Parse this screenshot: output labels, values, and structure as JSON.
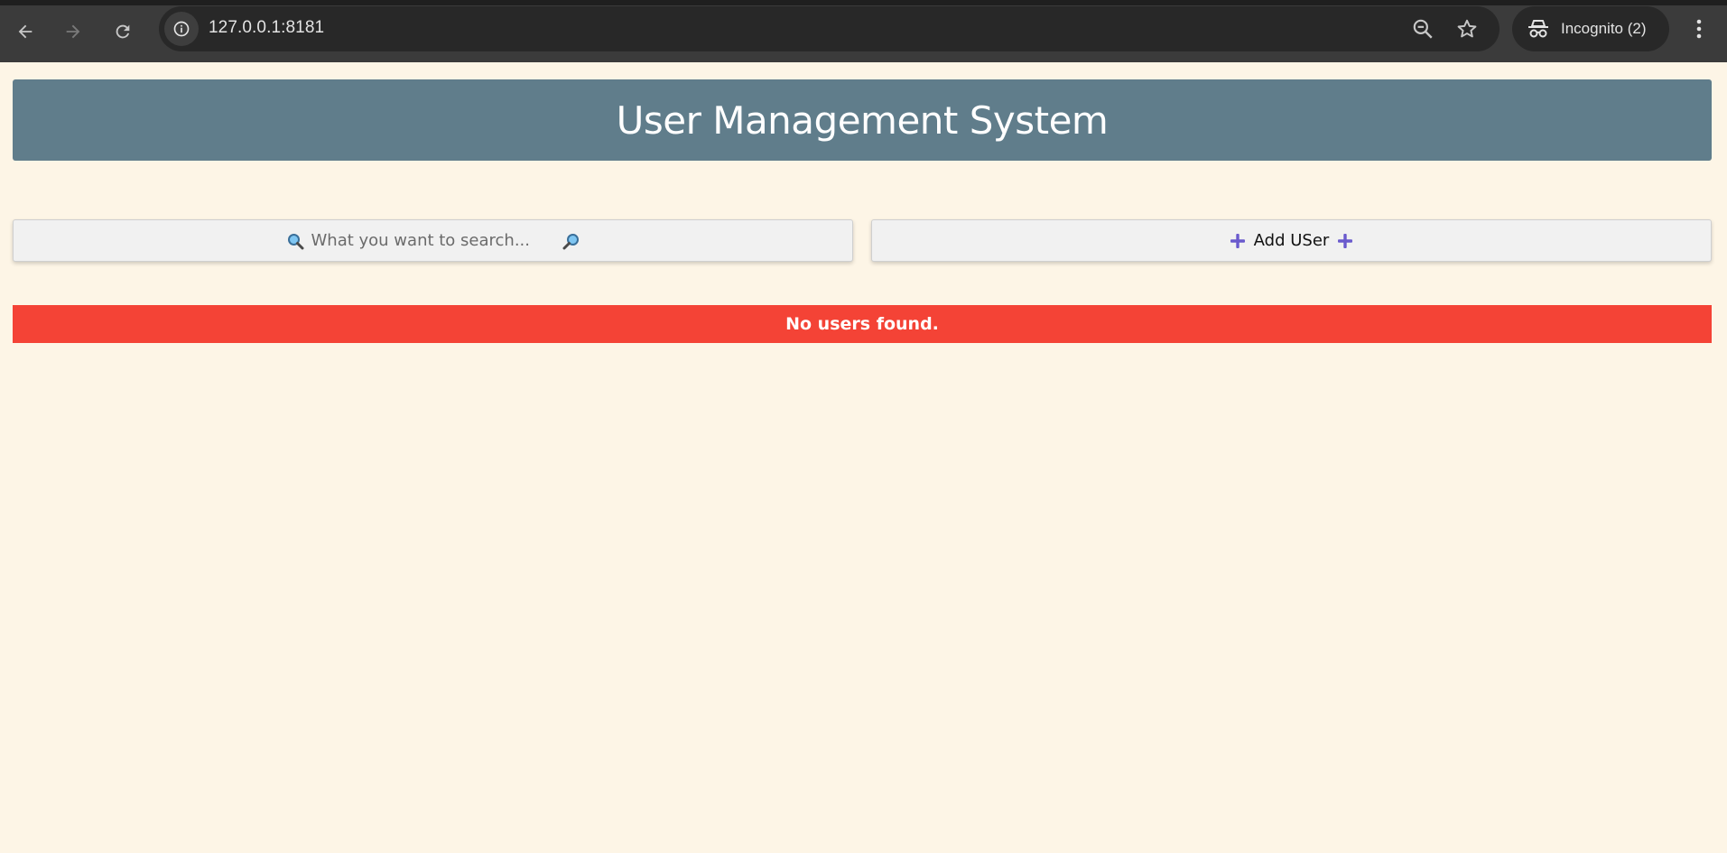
{
  "browser": {
    "url": "127.0.0.1:8181",
    "incognito_label": "Incognito (2)",
    "icons": {
      "back": "arrow-left-icon",
      "forward": "arrow-right-icon",
      "reload": "reload-icon",
      "site_info": "info-icon",
      "zoom": "zoom-out-icon",
      "bookmark": "star-icon",
      "incognito": "incognito-icon",
      "menu": "kebab-menu-icon"
    }
  },
  "header": {
    "title": "User Management System",
    "background_color": "#607d8b"
  },
  "search": {
    "placeholder": "What you want to search...",
    "value": "",
    "left_icon": "magnifier-left-icon",
    "right_icon": "magnifier-right-icon"
  },
  "add_user": {
    "label": "Add USer",
    "icon": "plus-icon",
    "icon_color": "#6a5acd"
  },
  "users": {
    "empty_message": "No users found.",
    "alert_color": "#f44336"
  },
  "page": {
    "background_color": "#fdf5e6"
  }
}
